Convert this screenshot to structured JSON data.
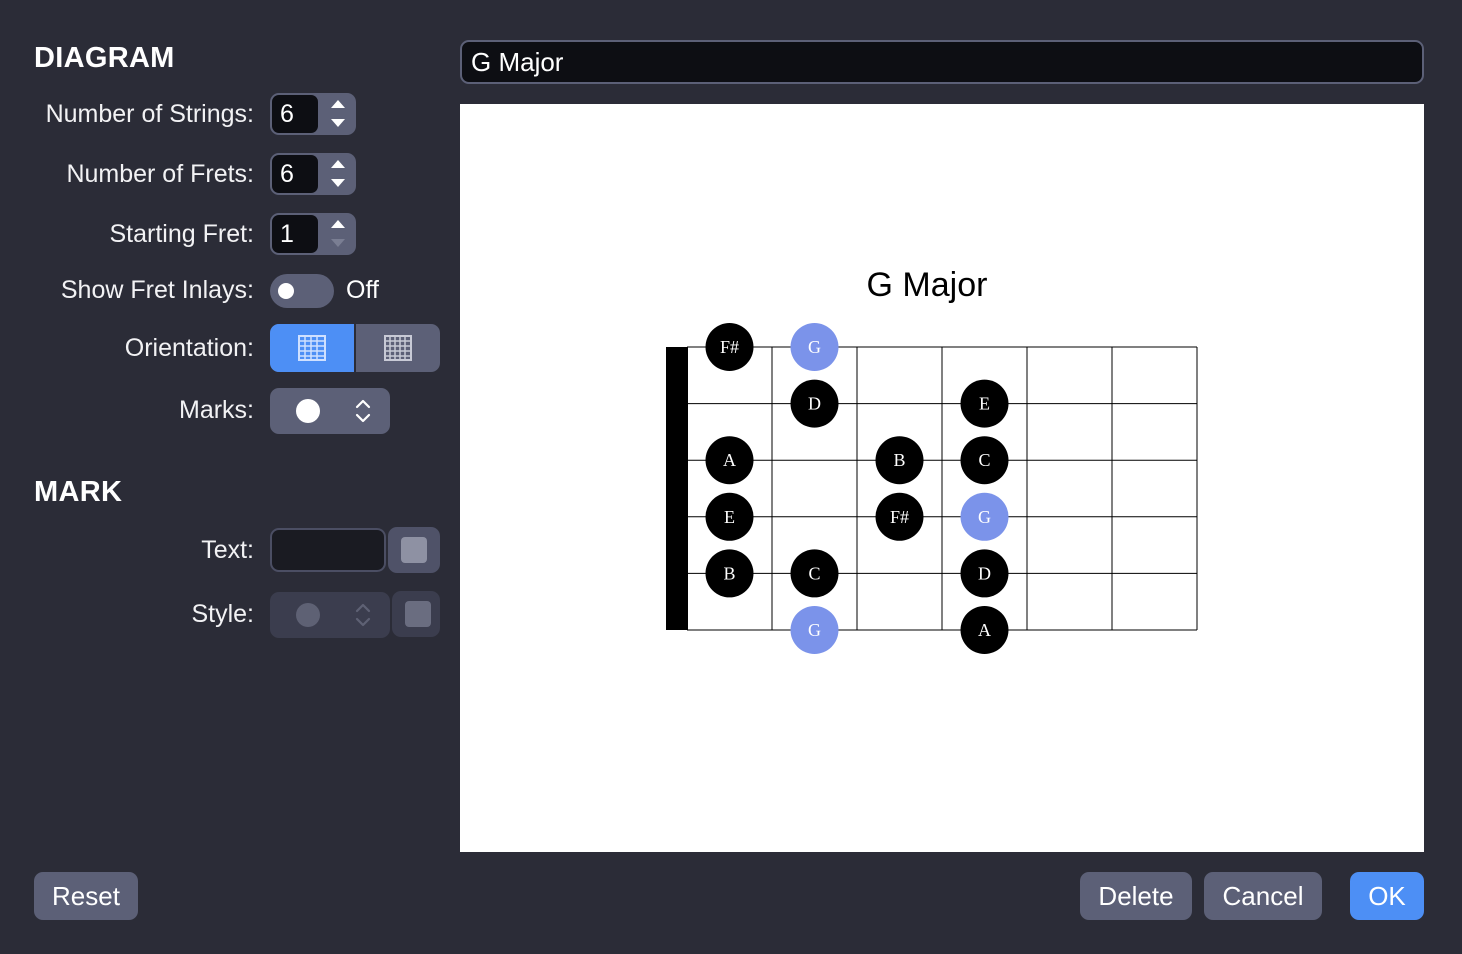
{
  "diagram_section": {
    "title": "DIAGRAM",
    "strings_label": "Number of Strings:",
    "strings_value": "6",
    "frets_label": "Number of Frets:",
    "frets_value": "6",
    "start_fret_label": "Starting Fret:",
    "start_fret_value": "1",
    "inlays_label": "Show Fret Inlays:",
    "inlays_state": "Off",
    "orientation_label": "Orientation:",
    "orientation_options": [
      "horizontal-grid-icon",
      "vertical-grid-icon"
    ],
    "orientation_selected": 0,
    "marks_label": "Marks:",
    "marks_value_icon": "filled-circle-icon"
  },
  "mark_section": {
    "title": "MARK",
    "text_label": "Text:",
    "text_value": "",
    "style_label": "Style:"
  },
  "chord_name": "G Major",
  "colors": {
    "accent": "#4d8ff5",
    "root_note": "#7b93ea",
    "note": "#000000",
    "background": "#2b2c37"
  },
  "fretboard": {
    "title": "G Major",
    "strings": 6,
    "frets": 6,
    "starting_fret": 1,
    "notes": [
      {
        "string": 1,
        "fret": 1,
        "label": "F#",
        "root": false
      },
      {
        "string": 1,
        "fret": 2,
        "label": "G",
        "root": true
      },
      {
        "string": 2,
        "fret": 2,
        "label": "D",
        "root": false
      },
      {
        "string": 2,
        "fret": 4,
        "label": "E",
        "root": false
      },
      {
        "string": 3,
        "fret": 1,
        "label": "A",
        "root": false
      },
      {
        "string": 3,
        "fret": 3,
        "label": "B",
        "root": false
      },
      {
        "string": 3,
        "fret": 4,
        "label": "C",
        "root": false
      },
      {
        "string": 4,
        "fret": 1,
        "label": "E",
        "root": false
      },
      {
        "string": 4,
        "fret": 3,
        "label": "F#",
        "root": false
      },
      {
        "string": 4,
        "fret": 4,
        "label": "G",
        "root": true
      },
      {
        "string": 5,
        "fret": 1,
        "label": "B",
        "root": false
      },
      {
        "string": 5,
        "fret": 2,
        "label": "C",
        "root": false
      },
      {
        "string": 5,
        "fret": 4,
        "label": "D",
        "root": false
      },
      {
        "string": 6,
        "fret": 2,
        "label": "G",
        "root": true
      },
      {
        "string": 6,
        "fret": 4,
        "label": "A",
        "root": false
      }
    ]
  },
  "buttons": {
    "reset": "Reset",
    "delete": "Delete",
    "cancel": "Cancel",
    "ok": "OK"
  }
}
